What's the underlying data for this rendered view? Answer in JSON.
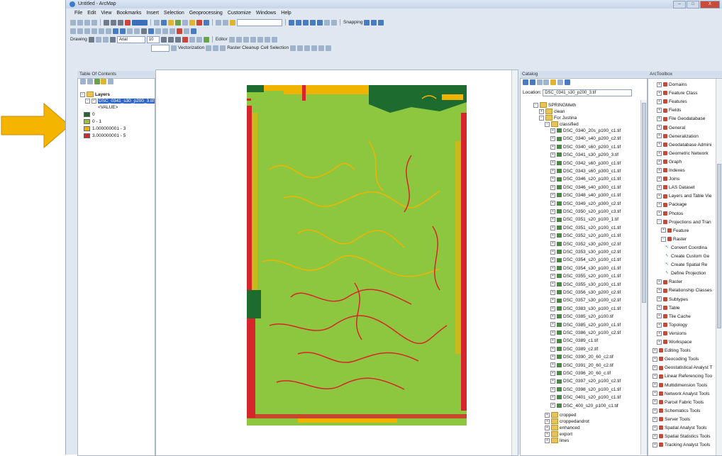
{
  "window": {
    "title": "Untitled - ArcMap",
    "buttons": [
      "–",
      "□",
      "X"
    ]
  },
  "menu": [
    "File",
    "Edit",
    "View",
    "Bookmarks",
    "Insert",
    "Selection",
    "Geoprocessing",
    "Customize",
    "Windows",
    "Help"
  ],
  "toolbars": {
    "snapping_label": "Snapping",
    "drawing_label": "Drawing",
    "font_name": "Arial",
    "font_size": "10",
    "editor_label": "Editor",
    "vectorization_label": "Vectorization",
    "raster_cleanup_label": "Raster Cleanup",
    "cell_selection_label": "Cell Selection"
  },
  "toc": {
    "title": "Table Of Contents",
    "layers_label": "Layers",
    "layer_name": "DSC_0341_s30_p200_3.tif",
    "value_header": "<VALUE>",
    "legend": [
      {
        "label": "0",
        "color": "#1e6b2f"
      },
      {
        "label": "0 - 1",
        "color": "#9bbf3a"
      },
      {
        "label": "1.000000001 - 3",
        "color": "#f0b400"
      },
      {
        "label": "3.000000001 - 5",
        "color": "#d7262b"
      }
    ]
  },
  "map": {
    "background": "#8dc63f",
    "colors": {
      "dark": "#1e6b2f",
      "field": "#8dc63f",
      "yellow": "#f0b400",
      "red": "#d7262b"
    }
  },
  "catalog": {
    "title": "Catalog",
    "location_label": "Location:",
    "location_value": "DSC_0341_s30_p200_3.tif",
    "folders": [
      "SPRINGMeth",
      "clean",
      "For Justina",
      "classified"
    ],
    "files": [
      "DSC_0340_20s_p100_c1.tif",
      "DSC_0340_s40_p200_c2.tif",
      "DSC_0340_s60_p200_c1.tif",
      "DSC_0341_s30_p200_3.tif",
      "DSC_0342_s60_p300_c1.tif",
      "DSC_0343_s60_p300_c1.tif",
      "DSC_0346_s20_p100_c1.tif",
      "DSC_0346_s40_p300_c1.tif",
      "DSC_0348_s40_p300_c1.tif",
      "DSC_0349_s20_p300_c2.tif",
      "DSC_0350_s20_p100_c3.tif",
      "DSC_0351_s20_p100_1.tif",
      "DSC_0351_s20_p100_c1.tif",
      "DSC_0352_s20_p100_c1.tif",
      "DSC_0352_s30_p200_c2.tif",
      "DSC_0353_s30_p100_c2.tif",
      "DSC_0354_s20_p100_c1.tif",
      "DSC_0354_s30_p100_c1.tif",
      "DSC_0355_s20_p100_c1.tif",
      "DSC_0355_s30_p100_c1.tif",
      "DSC_0356_s30_p200_c2.tif",
      "DSC_0357_s30_p100_c2.tif",
      "DSC_0383_s30_p100_c1.tif",
      "DSC_0385_s20_p100.tif",
      "DSC_0385_s20_p100_c1.tif",
      "DSC_0386_s20_p100_c2.tif",
      "DSC_0389_c1.tif",
      "DSC_0389_c2.tif",
      "DSC_0390_20_60_c2.tif",
      "DSC_0391_20_60_c2.tif",
      "DSC_0396_20_60_c.tif",
      "DSC_0397_s20_p100_c2.tif",
      "DSC_0398_s20_p100_c1.tif",
      "DSC_0401_s20_p100_c1.tif",
      "DSC_400_s20_p100_c1.tif"
    ],
    "bottom_folders": [
      "cropped",
      "croppedandrot",
      "enhanced",
      "export",
      "lines"
    ]
  },
  "toolbox": {
    "title": "ArcToolbox",
    "items": [
      {
        "label": "Domains",
        "level": 1
      },
      {
        "label": "Feature Class",
        "level": 1
      },
      {
        "label": "Features",
        "level": 1
      },
      {
        "label": "Fields",
        "level": 1
      },
      {
        "label": "File Geodatabase",
        "level": 1
      },
      {
        "label": "General",
        "level": 1
      },
      {
        "label": "Generalization",
        "level": 1
      },
      {
        "label": "Geodatabase Admini",
        "level": 1
      },
      {
        "label": "Geometric Network",
        "level": 1
      },
      {
        "label": "Graph",
        "level": 1
      },
      {
        "label": "Indexes",
        "level": 1
      },
      {
        "label": "Joins",
        "level": 1
      },
      {
        "label": "LAS Dataset",
        "level": 1
      },
      {
        "label": "Layers and Table Vie",
        "level": 1
      },
      {
        "label": "Package",
        "level": 1
      },
      {
        "label": "Photos",
        "level": 1
      },
      {
        "label": "Projections and Tran",
        "level": 1
      },
      {
        "label": "Feature",
        "level": 2
      },
      {
        "label": "Raster",
        "level": 2
      },
      {
        "label": "Convert Coordina",
        "level": 3
      },
      {
        "label": "Create Custom Ge",
        "level": 3
      },
      {
        "label": "Create Spatial Re",
        "level": 3
      },
      {
        "label": "Define Projection",
        "level": 3
      },
      {
        "label": "Raster",
        "level": 1
      },
      {
        "label": "Relationship Classes",
        "level": 1
      },
      {
        "label": "Subtypes",
        "level": 1
      },
      {
        "label": "Table",
        "level": 1
      },
      {
        "label": "Tile Cache",
        "level": 1
      },
      {
        "label": "Topology",
        "level": 1
      },
      {
        "label": "Versions",
        "level": 1
      },
      {
        "label": "Workspace",
        "level": 1
      },
      {
        "label": "Editing Tools",
        "level": 0
      },
      {
        "label": "Geocoding Tools",
        "level": 0
      },
      {
        "label": "Geostatistical Analyst T",
        "level": 0
      },
      {
        "label": "Linear Referencing Too",
        "level": 0
      },
      {
        "label": "Multidimension Tools",
        "level": 0
      },
      {
        "label": "Network Analyst Tools",
        "level": 0
      },
      {
        "label": "Parcel Fabric Tools",
        "level": 0
      },
      {
        "label": "Schematics Tools",
        "level": 0
      },
      {
        "label": "Server Tools",
        "level": 0
      },
      {
        "label": "Spatial Analyst Tools",
        "level": 0
      },
      {
        "label": "Spatial Statistics Tools",
        "level": 0
      },
      {
        "label": "Tracking Analyst Tools",
        "level": 0
      }
    ]
  },
  "pointer": {
    "color": "#f5b400"
  }
}
